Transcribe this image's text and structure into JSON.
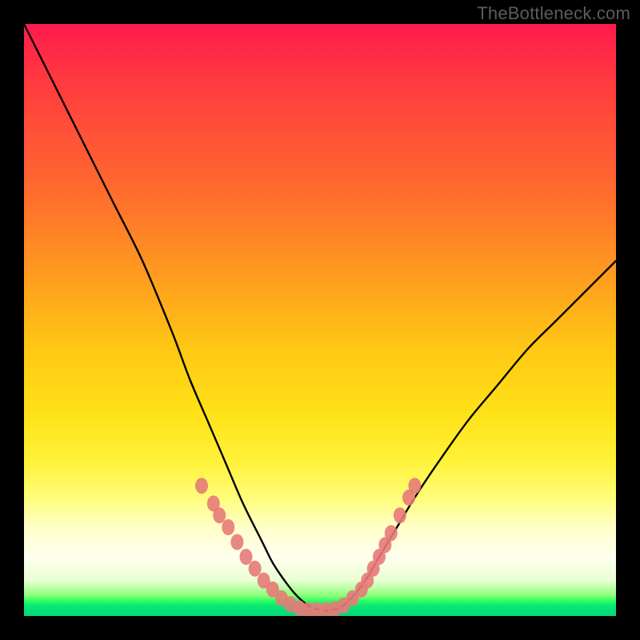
{
  "watermark": "TheBottleneck.com",
  "chart_data": {
    "type": "line",
    "title": "",
    "xlabel": "",
    "ylabel": "",
    "xlim": [
      0,
      100
    ],
    "ylim": [
      0,
      100
    ],
    "series": [
      {
        "name": "bottleneck-curve",
        "x": [
          0,
          5,
          10,
          15,
          20,
          25,
          28,
          31,
          34,
          37,
          40,
          42,
          44,
          46,
          48,
          50,
          52,
          54,
          56,
          58,
          60,
          63,
          66,
          70,
          75,
          80,
          85,
          90,
          95,
          100
        ],
        "y": [
          100,
          90,
          80,
          70,
          60,
          48,
          40,
          33,
          26,
          19,
          13,
          9,
          6,
          3.5,
          1.8,
          1.0,
          1.0,
          1.8,
          3.8,
          6.5,
          10,
          15,
          20,
          26,
          33,
          39,
          45,
          50,
          55,
          60
        ]
      }
    ],
    "markers": {
      "name": "sample-dots",
      "color": "#e77a78",
      "points": [
        {
          "x": 30,
          "y": 22
        },
        {
          "x": 32,
          "y": 19
        },
        {
          "x": 33,
          "y": 17
        },
        {
          "x": 34.5,
          "y": 15
        },
        {
          "x": 36,
          "y": 12.5
        },
        {
          "x": 37.5,
          "y": 10
        },
        {
          "x": 39,
          "y": 8
        },
        {
          "x": 40.5,
          "y": 6
        },
        {
          "x": 42,
          "y": 4.5
        },
        {
          "x": 43.5,
          "y": 3
        },
        {
          "x": 45,
          "y": 2
        },
        {
          "x": 46.5,
          "y": 1.3
        },
        {
          "x": 48,
          "y": 1.0
        },
        {
          "x": 49.5,
          "y": 1.0
        },
        {
          "x": 51,
          "y": 1.0
        },
        {
          "x": 52.5,
          "y": 1.2
        },
        {
          "x": 54,
          "y": 1.8
        },
        {
          "x": 55.5,
          "y": 3
        },
        {
          "x": 57,
          "y": 4.5
        },
        {
          "x": 58,
          "y": 6
        },
        {
          "x": 59,
          "y": 8
        },
        {
          "x": 60,
          "y": 10
        },
        {
          "x": 61,
          "y": 12
        },
        {
          "x": 62,
          "y": 14
        },
        {
          "x": 63.5,
          "y": 17
        },
        {
          "x": 65,
          "y": 20
        },
        {
          "x": 66,
          "y": 22
        }
      ]
    }
  }
}
